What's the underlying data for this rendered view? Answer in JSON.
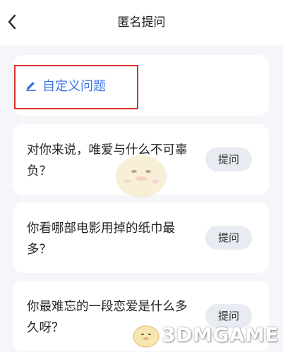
{
  "header": {
    "title": "匿名提问",
    "back_icon": "chevron-left-icon"
  },
  "custom": {
    "label": "自定义问题",
    "icon": "pencil-icon",
    "accent": "#3d74e6",
    "highlight": "#d9302a"
  },
  "questions": [
    {
      "text": "对你来说，唯爱与什么不可辜负？",
      "button": "提问"
    },
    {
      "text": "你看哪部电影用掉的纸巾最多？",
      "button": "提问"
    },
    {
      "text": "你最难忘的一段恋爱是什么多久呀？",
      "button": "提问"
    }
  ],
  "watermark": {
    "text": "3DMGAME"
  }
}
